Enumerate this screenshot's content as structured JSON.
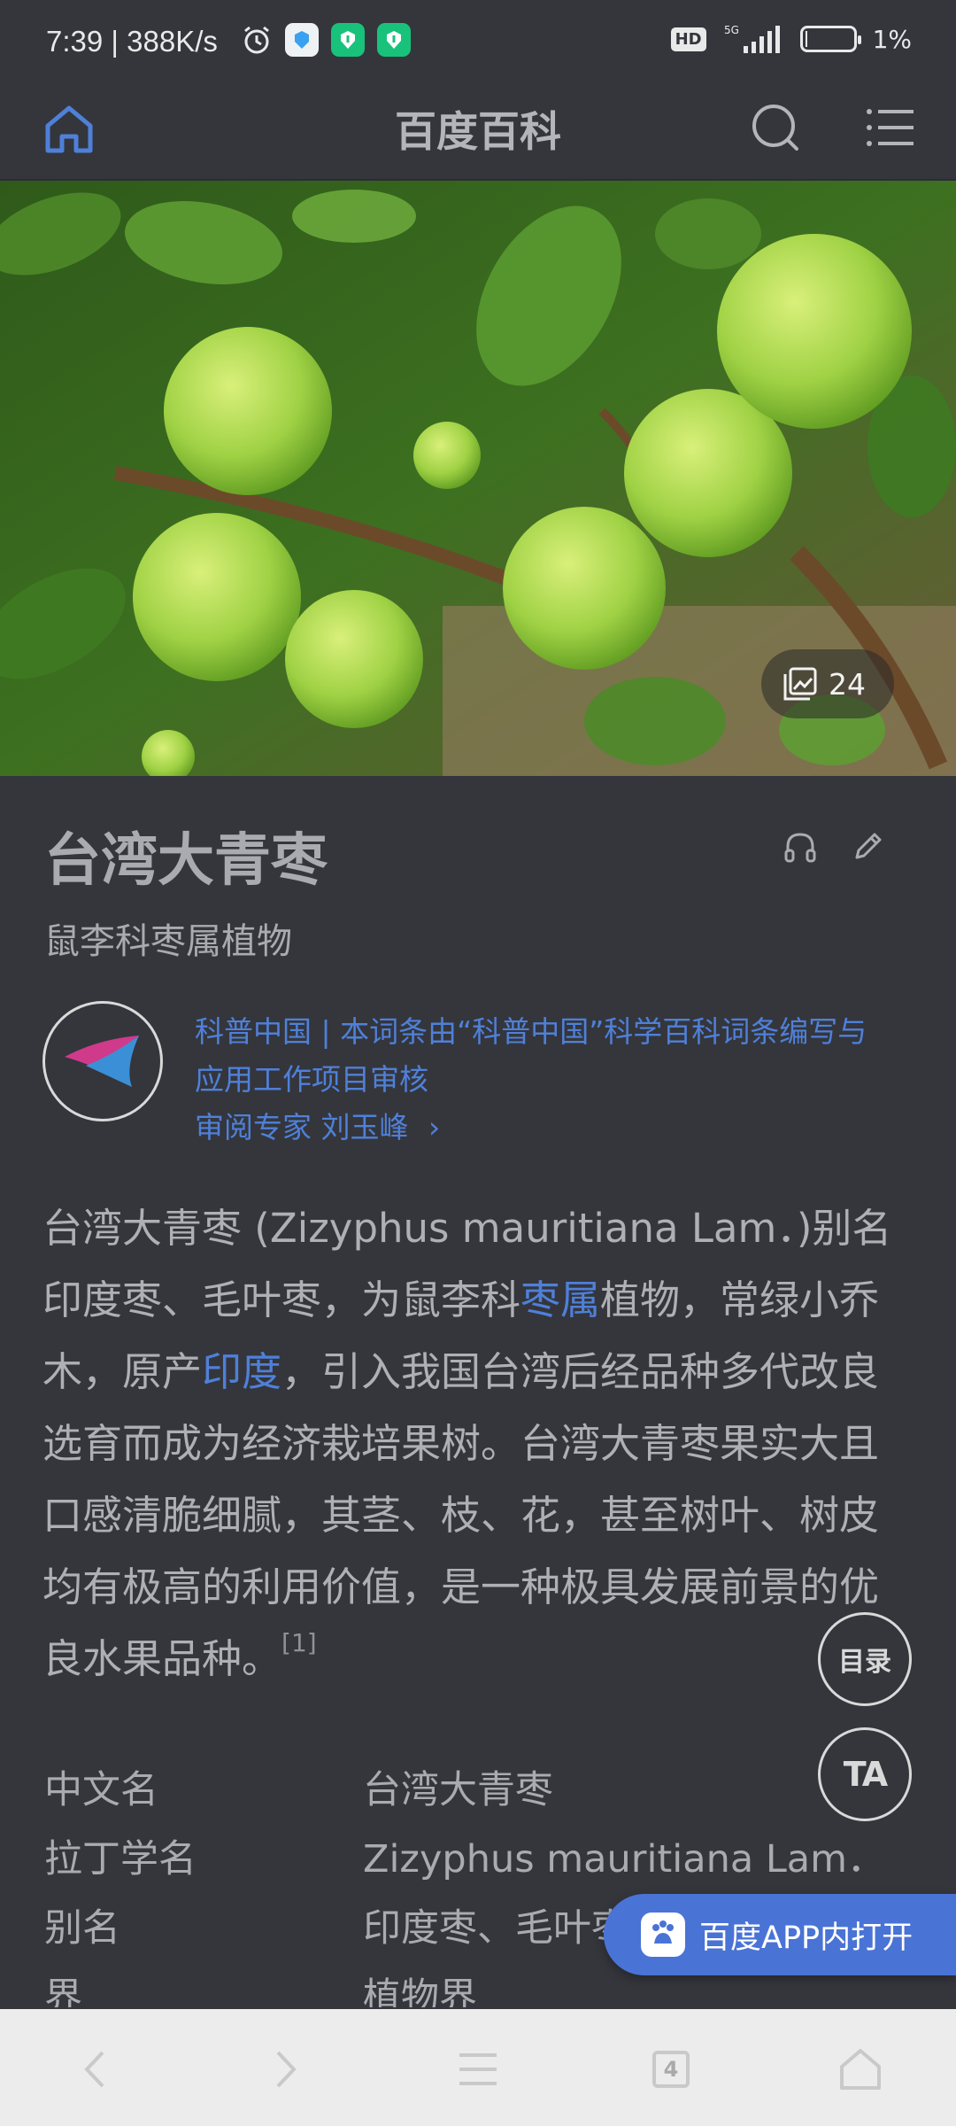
{
  "status_bar": {
    "time": "7:39",
    "speed": "388K/s",
    "hd_label": "HD",
    "network_label": "5G",
    "battery": "1%"
  },
  "nav": {
    "title": "百度百科",
    "icons": [
      "home-icon",
      "search-icon",
      "menu-icon"
    ]
  },
  "hero": {
    "image_count": "24"
  },
  "entry": {
    "title": "台湾大青枣",
    "subtitle": "鼠李科枣属植物"
  },
  "source": {
    "line1": "科普中国 | 本词条由“科普中国”科学百科词条编写与",
    "line2": "应用工作项目审核",
    "reviewer_label": "审阅专家 刘玉峰",
    "reviewer_chevron": "›"
  },
  "summary": {
    "part1": "台湾大青枣 (Zizyphus mauritiana Lam．)别名印度枣、毛叶枣，为鼠李科",
    "link1": "枣属",
    "part2": "植物，常绿小乔木，原产",
    "link2": "印度",
    "part3": "，引入我国台湾后经品种多代改良选育而成为经济栽培果树。台湾大青枣果实大且口感清脆细腻，其茎、枝、花，甚至树叶、树皮均有极高的利用价值，是一种极具发展前景的优良水果品种。",
    "ref": "[1]"
  },
  "floating": {
    "toc_label": "目录",
    "ta_label": "TA"
  },
  "infobox": {
    "rows": [
      {
        "key": "中文名",
        "value": "台湾大青枣"
      },
      {
        "key": "拉丁学名",
        "value": "Zizyphus mauritiana Lam．"
      },
      {
        "key": "别名",
        "value": "印度枣、毛叶枣"
      },
      {
        "key": "界",
        "value": "植物界"
      }
    ]
  },
  "open_app": {
    "label": "百度APP内打开"
  },
  "bottom_bar": {
    "tab_count": "4",
    "colors": {
      "icon": "#c9c9c9"
    }
  }
}
